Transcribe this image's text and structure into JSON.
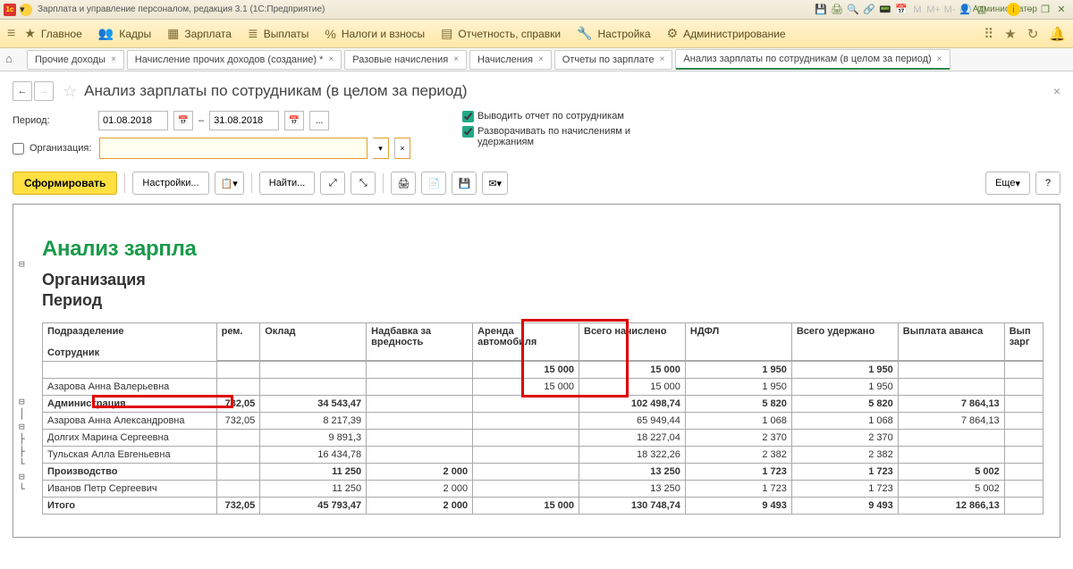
{
  "titlebar": {
    "text": "Зарплата и управление персоналом, редакция 3.1  (1С:Предприятие)",
    "user": "Администратор"
  },
  "menu": {
    "items": [
      "Главное",
      "Кадры",
      "Зарплата",
      "Выплаты",
      "Налоги и взносы",
      "Отчетность, справки",
      "Настройка",
      "Администрирование"
    ]
  },
  "tabs": [
    "Прочие доходы",
    "Начисление прочих доходов (создание) *",
    "Разовые начисления",
    "Начисления",
    "Отчеты по зарплате",
    "Анализ зарплаты по сотрудникам (в целом за период)"
  ],
  "page_title": "Анализ зарплаты по сотрудникам (в целом за период)",
  "params": {
    "period_label": "Период:",
    "date_from": "01.08.2018",
    "date_to": "31.08.2018",
    "dash": "–",
    "org_label": "Организация:",
    "chk1": "Выводить отчет по сотрудникам",
    "chk2": "Разворачивать по начислениям и удержаниям"
  },
  "toolbar": {
    "generate": "Сформировать",
    "settings": "Настройки...",
    "find": "Найти...",
    "more": "Еще",
    "help": "?"
  },
  "report": {
    "title": "Анализ зарпла",
    "sub1": "Организация",
    "sub2": "Период",
    "hdr": {
      "c1": "Подразделение",
      "c1b": "Сотрудник",
      "c2": "рем.",
      "c3": "Оклад",
      "c4": "Надбавка за вредность",
      "c5": "Аренда автомобиля",
      "c6": "Всего начислено",
      "c7": "НДФЛ",
      "c8": "Всего удержано",
      "c9": "Выплата аванса",
      "c10": "Вып зарг"
    },
    "rows": [
      {
        "b": 1,
        "c1": "",
        "c2": "",
        "c3": "",
        "c4": "",
        "c5": "15 000",
        "c6": "15 000",
        "c7": "1 950",
        "c8": "1 950",
        "c9": ""
      },
      {
        "b": 0,
        "c1": "Азарова Анна Валерьевна",
        "c2": "",
        "c3": "",
        "c4": "",
        "c5": "15 000",
        "c6": "15 000",
        "c7": "1 950",
        "c8": "1 950",
        "c9": ""
      },
      {
        "b": 1,
        "c1": "Администрация",
        "c2": "732,05",
        "c3": "34 543,47",
        "c4": "",
        "c5": "",
        "c6": "102 498,74",
        "c7": "5 820",
        "c8": "5 820",
        "c9": "7 864,13"
      },
      {
        "b": 0,
        "c1": "Азарова Анна Александровна",
        "c2": "732,05",
        "c3": "8 217,39",
        "c4": "",
        "c5": "",
        "c6": "65 949,44",
        "c7": "1 068",
        "c8": "1 068",
        "c9": "7 864,13"
      },
      {
        "b": 0,
        "c1": "Долгих Марина Сергеевна",
        "c2": "",
        "c3": "9 891,3",
        "c4": "",
        "c5": "",
        "c6": "18 227,04",
        "c7": "2 370",
        "c8": "2 370",
        "c9": ""
      },
      {
        "b": 0,
        "c1": "Тульская Алла Евгеньевна",
        "c2": "",
        "c3": "16 434,78",
        "c4": "",
        "c5": "",
        "c6": "18 322,26",
        "c7": "2 382",
        "c8": "2 382",
        "c9": ""
      },
      {
        "b": 1,
        "c1": "Производство",
        "c2": "",
        "c3": "11 250",
        "c4": "2 000",
        "c5": "",
        "c6": "13 250",
        "c7": "1 723",
        "c8": "1 723",
        "c9": "5 002"
      },
      {
        "b": 0,
        "c1": "Иванов Петр Сергеевич",
        "c2": "",
        "c3": "11 250",
        "c4": "2 000",
        "c5": "",
        "c6": "13 250",
        "c7": "1 723",
        "c8": "1 723",
        "c9": "5 002"
      },
      {
        "b": 1,
        "c1": "Итого",
        "c2": "732,05",
        "c3": "45 793,47",
        "c4": "2 000",
        "c5": "15 000",
        "c6": "130 748,74",
        "c7": "9 493",
        "c8": "9 493",
        "c9": "12 866,13"
      }
    ]
  }
}
